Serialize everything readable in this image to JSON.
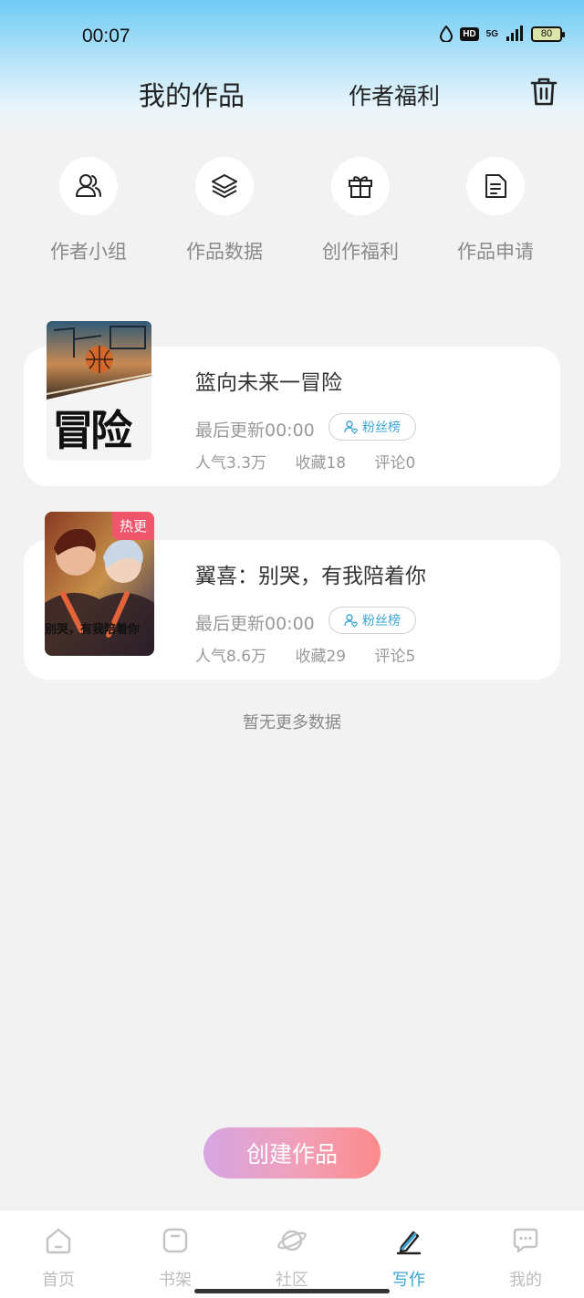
{
  "status_bar": {
    "time": "00:07",
    "hd": "HD",
    "network": "5G",
    "battery": "80"
  },
  "header": {
    "tab_my_works": "我的作品",
    "tab_author_benefits": "作者福利"
  },
  "quick_actions": [
    {
      "label": "作者小组",
      "icon": "group-icon"
    },
    {
      "label": "作品数据",
      "icon": "layers-icon"
    },
    {
      "label": "创作福利",
      "icon": "gift-icon"
    },
    {
      "label": "作品申请",
      "icon": "document-icon"
    }
  ],
  "works": [
    {
      "title": "篮向未来一冒险",
      "cover_text": "冒险",
      "last_update": "最后更新00:00",
      "fan_rank": "粉丝榜",
      "popularity": "人气3.3万",
      "favorites": "收藏18",
      "comments": "评论0"
    },
    {
      "title": "翼喜：别哭，有我陪着你",
      "cover_text": "别哭，有我陪着你",
      "hot_badge": "热更",
      "last_update": "最后更新00:00",
      "fan_rank": "粉丝榜",
      "popularity": "人气8.6万",
      "favorites": "收藏29",
      "comments": "评论5"
    }
  ],
  "no_more_text": "暂无更多数据",
  "create_button": "创建作品",
  "bottom_nav": [
    {
      "label": "首页",
      "icon": "home-icon",
      "active": false
    },
    {
      "label": "书架",
      "icon": "bookshelf-icon",
      "active": false
    },
    {
      "label": "社区",
      "icon": "planet-icon",
      "active": false
    },
    {
      "label": "写作",
      "icon": "pen-icon",
      "active": true
    },
    {
      "label": "我的",
      "icon": "chat-bubble-icon",
      "active": false
    }
  ],
  "colors": {
    "accent": "#3aa3d8",
    "hot": "#f0566b"
  }
}
